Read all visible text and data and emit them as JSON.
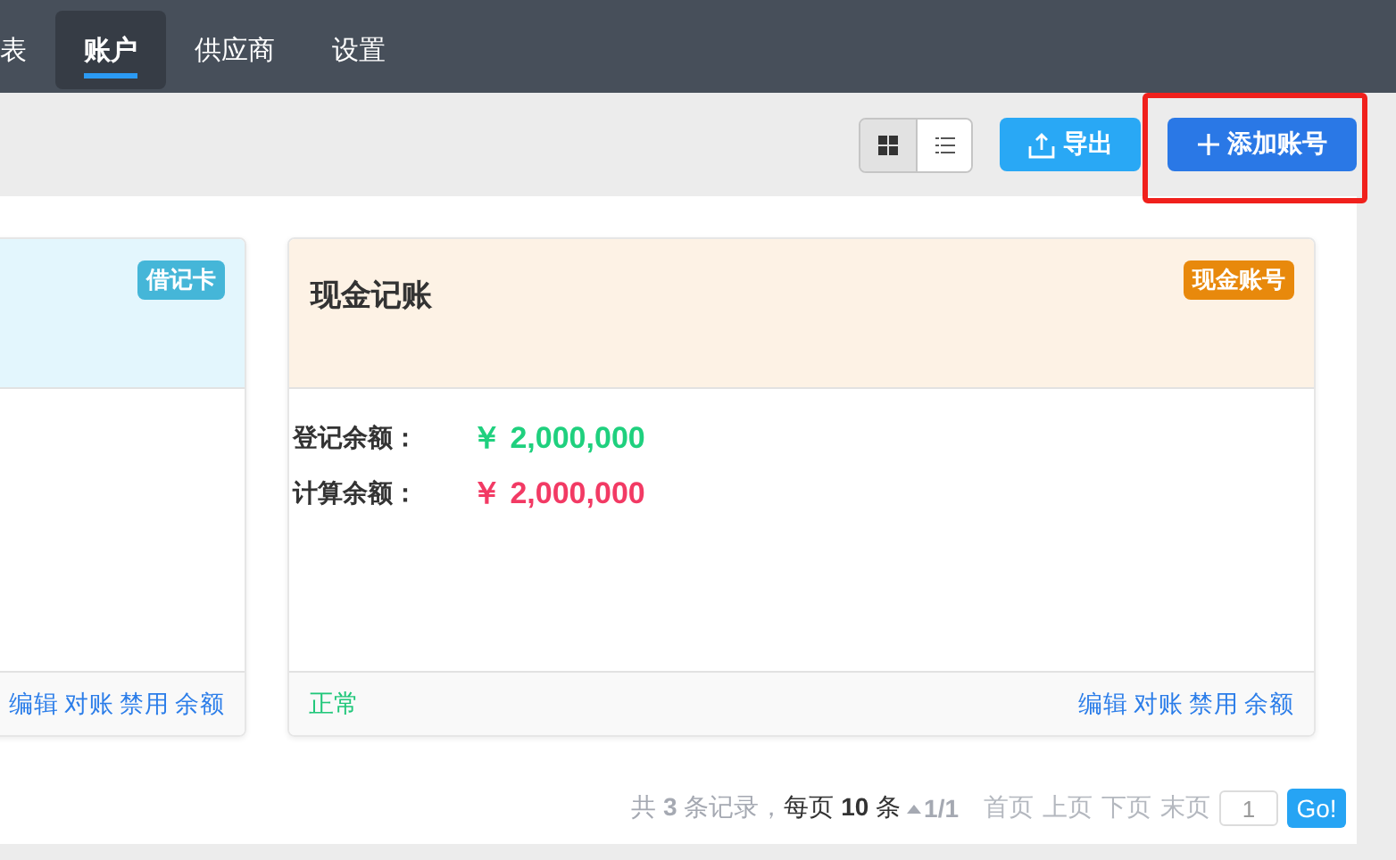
{
  "nav": {
    "items": [
      {
        "label": "表",
        "selected": false
      },
      {
        "label": "账户",
        "selected": true
      },
      {
        "label": "供应商",
        "selected": false
      },
      {
        "label": "设置",
        "selected": false
      }
    ]
  },
  "toolbar": {
    "views": [
      {
        "kind": "grid",
        "selected": true
      },
      {
        "kind": "list",
        "selected": false
      }
    ],
    "export_button": "导出",
    "add_button": {
      "label": "添加账号",
      "highlighted": true
    }
  },
  "cards": [
    {
      "kind": "debit",
      "tag": "借记卡",
      "color": "#45b6d8",
      "actions": [
        "编辑",
        "对账",
        "禁用",
        "余额"
      ]
    },
    {
      "kind": "cash",
      "title": "现金记账",
      "tag": "现金账号",
      "color": "#e8890c",
      "balances": [
        {
          "label": "登记余额：",
          "value": "￥ 2,000,000",
          "color": "#1fd07e"
        },
        {
          "label": "计算余额：",
          "value": "￥ 2,000,000",
          "color": "#f23a64"
        }
      ],
      "status": "正常",
      "actions": [
        "编辑",
        "对账",
        "禁用",
        "余额"
      ]
    }
  ],
  "pagination": {
    "summary": "共 **3** 条记录，",
    "per_page": "每页 **10** 条",
    "page": "1/1",
    "links": [
      {
        "label": "首页",
        "disabled": true
      },
      {
        "label": "上页",
        "disabled": true
      },
      {
        "label": "下页",
        "disabled": true
      },
      {
        "label": "末页",
        "disabled": true
      }
    ],
    "page_input": "1",
    "go_button": "Go!"
  }
}
